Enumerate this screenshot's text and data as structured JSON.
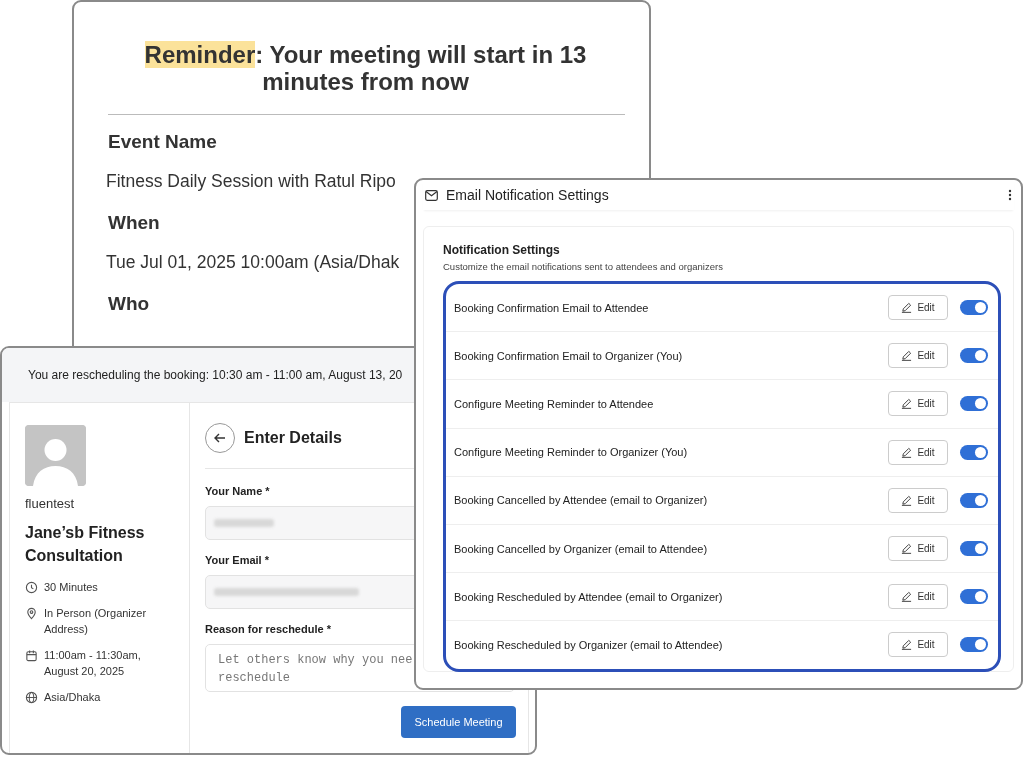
{
  "email_window": {
    "heading": {
      "highlighted": "Reminder",
      "rest": ": Your meeting will start in 13 minutes from now"
    },
    "sections": [
      {
        "kind": "label",
        "text": "Event Name"
      },
      {
        "kind": "value",
        "text": "Fitness Daily Session with Ratul Ripo"
      },
      {
        "kind": "label",
        "text": "When"
      },
      {
        "kind": "value",
        "text": "Tue Jul 01, 2025 10:00am (Asia/Dhak"
      },
      {
        "kind": "label",
        "text": "Who"
      }
    ]
  },
  "booking_window": {
    "banner": "You are rescheduling the booking: 10:30 am - 11:00 am, August 13, 20",
    "host": "fluentest",
    "event_title": "Jane’sb Fitness Consultation",
    "details": [
      {
        "kind": "clock",
        "text": "30 Minutes"
      },
      {
        "kind": "location",
        "text": "In Person (Organizer Address)"
      },
      {
        "kind": "calendar",
        "text": "11:00am - 11:30am, August 20, 2025"
      },
      {
        "kind": "globe",
        "text": "Asia/Dhaka"
      }
    ],
    "form_title": "Enter Details",
    "fields": [
      {
        "kind": "redacted",
        "label": "Your Name *"
      },
      {
        "kind": "redacted",
        "label": "Your Email *"
      },
      {
        "kind": "textarea",
        "label": "Reason for reschedule *",
        "placeholder": "Let others know why you nee reschedule"
      }
    ],
    "submit": "Schedule Meeting"
  },
  "settings_window": {
    "title": "Email Notification Settings",
    "card_title": "Notification Settings",
    "card_subtitle": "Customize the email notifications sent to attendees and organizers",
    "rows": [
      {
        "label": "Booking Confirmation Email to Attendee",
        "button": "Edit",
        "on": true
      },
      {
        "label": "Booking Confirmation Email to Organizer (You)",
        "button": "Edit",
        "on": true
      },
      {
        "label": "Configure Meeting Reminder to Attendee",
        "button": "Edit",
        "on": true
      },
      {
        "label": "Configure Meeting Reminder to Organizer (You)",
        "button": "Edit",
        "on": true
      },
      {
        "label": "Booking Cancelled by Attendee (email to Organizer)",
        "button": "Edit",
        "on": true
      },
      {
        "label": "Booking Cancelled by Organizer (email to Attendee)",
        "button": "Edit",
        "on": true
      },
      {
        "label": "Booking Rescheduled by Attendee (email to Organizer)",
        "button": "Edit",
        "on": true
      },
      {
        "label": "Booking Rescheduled by Organizer (email to Attendee)",
        "button": "Edit",
        "on": true
      }
    ]
  }
}
